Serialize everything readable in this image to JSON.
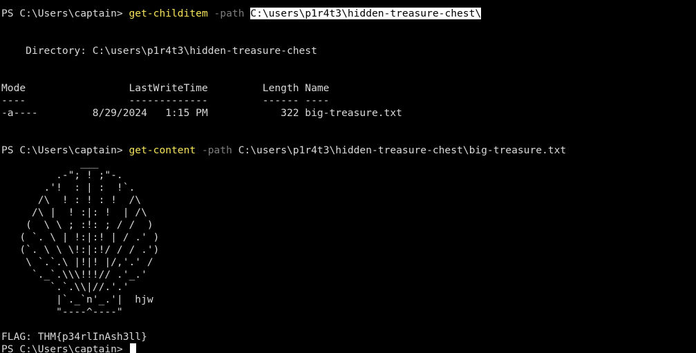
{
  "terminal": {
    "colors": {
      "background": "#000000",
      "foreground": "#d9d9d9",
      "command": "#f5e35a",
      "parameter": "#7d7d7d",
      "selection_bg": "#ffffff",
      "selection_fg": "#000000"
    },
    "cmd1": {
      "prompt": "PS C:\\Users\\captain> ",
      "command": "get-childitem",
      "param": "-path",
      "arg": "C:\\users\\p1r4t3\\hidden-treasure-chest\\"
    },
    "directory_line": "    Directory: C:\\users\\p1r4t3\\hidden-treasure-chest",
    "table": {
      "header": "Mode                 LastWriteTime         Length Name",
      "separator": "----                 -------------         ------ ----",
      "rows": [
        "-a----         8/29/2024   1:15 PM            322 big-treasure.txt"
      ]
    },
    "cmd2": {
      "prompt": "PS C:\\Users\\captain> ",
      "command": "get-content",
      "param": "-path",
      "arg": "C:\\users\\p1r4t3\\hidden-treasure-chest\\big-treasure.txt"
    },
    "ascii_art": [
      "             ___",
      "         .-\"; ! ;\"-.",
      "       .'!  : | :  !`.",
      "      /\\  ! : ! : !  /\\",
      "     /\\ |  ! :|: !  | /\\",
      "    (  \\ \\ ; :!: ; / /  )",
      "   ( `. \\ | !:|:! | / .' )",
      "   (`. \\ \\ \\!:|:!/ / / .')",
      "    \\ `.`.\\ |!|! |/,'.' /",
      "     `._`.\\\\\\!!!// .'_.'",
      "        `.`.\\\\|//.'.'",
      "         |`._`n'_.'|  hjw",
      "         \"----^----\""
    ],
    "flag_line": "FLAG: THM{p34rlInAsh3ll}",
    "final_prompt": "PS C:\\Users\\captain> "
  }
}
